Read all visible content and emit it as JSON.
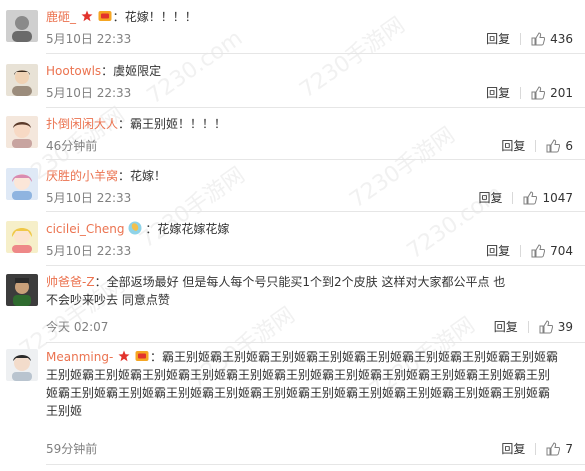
{
  "comments": [
    {
      "user": "鹿砸_",
      "sep": "：",
      "text": "花嫁！！！！",
      "time": "5月10日 22:33",
      "reply": "回复",
      "likes": "436"
    },
    {
      "user": "Hootowls",
      "sep": "：",
      "text": "虞姬限定",
      "time": "5月10日 22:33",
      "reply": "回复",
      "likes": "201"
    },
    {
      "user": "扑倒闲闲大人",
      "sep": "：",
      "text": "霸王别姬！！！！",
      "time": "46分钟前",
      "reply": "回复",
      "likes": "6"
    },
    {
      "user": "厌胜的小羊窝",
      "sep": "：",
      "text": "花嫁！",
      "time": "5月10日 22:33",
      "reply": "回复",
      "likes": "1047"
    },
    {
      "user": "cicilei_Cheng",
      "sep": "：",
      "text": "花嫁花嫁花嫁",
      "time": "5月10日 22:33",
      "reply": "回复",
      "likes": "704"
    },
    {
      "user": "帅爸爸-Z",
      "sep": "：",
      "text": "全部返场最好 但是每人每个号只能买1个到2个皮肤 这样对大家都公平点 也不会吵来吵去 同意点赞",
      "time": "今天 02:07",
      "reply": "回复",
      "likes": "39"
    },
    {
      "user": "Meanming-",
      "sep": "：",
      "text": "霸王别姬霸王别姬霸王别姬霸王别姬霸王别姬霸王别姬霸王别姬霸王别姬霸王别姬霸王别姬霸王别姬霸王别姬霸王别姬霸王别姬霸王别姬霸王别姬霸王别姬霸王别姬霸王别姬霸王别姬霸王别姬霸王别姬霸王别姬霸王别姬霸王别姬霸王别姬霸王别姬霸王别姬霸王别姬霸王别姬",
      "time": "59分钟前",
      "reply": "回复",
      "likes": "7"
    }
  ],
  "watermark": "7230手游网",
  "watermark_url": "7230.com",
  "colors": {
    "username": "#eb7350",
    "meta": "#808080",
    "divider": "#e6e6e6"
  }
}
